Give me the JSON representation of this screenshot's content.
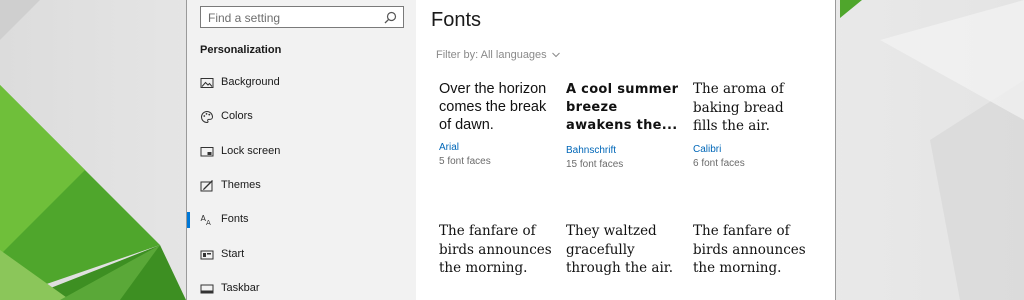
{
  "search": {
    "placeholder": "Find a setting"
  },
  "sidebar": {
    "section_title": "Personalization",
    "items": [
      {
        "label": "Background",
        "icon": "image-icon"
      },
      {
        "label": "Colors",
        "icon": "palette-icon"
      },
      {
        "label": "Lock screen",
        "icon": "lock-screen-icon"
      },
      {
        "label": "Themes",
        "icon": "brush-icon"
      },
      {
        "label": "Fonts",
        "icon": "font-icon",
        "active": true
      },
      {
        "label": "Start",
        "icon": "start-icon"
      },
      {
        "label": "Taskbar",
        "icon": "taskbar-icon"
      }
    ]
  },
  "main": {
    "title": "Fonts",
    "filter_label": "Filter by: All languages",
    "fonts": [
      {
        "sample": "Over the horizon comes the break of dawn.",
        "name": "Arial",
        "faces": "5 font faces"
      },
      {
        "sample": "A cool summer breeze awakens the...",
        "name": "Bahnschrift",
        "faces": "15 font faces"
      },
      {
        "sample": "The aroma of baking bread fills the air.",
        "name": "Calibri",
        "faces": "6 font faces"
      },
      {
        "sample": "The fanfare of birds announces the morning.",
        "name": "",
        "faces": ""
      },
      {
        "sample": "They waltzed gracefully through the air.",
        "name": "",
        "faces": ""
      },
      {
        "sample": "The fanfare of birds announces the morning.",
        "name": "",
        "faces": ""
      }
    ]
  },
  "colors": {
    "accent": "#0078d7",
    "link": "#0067b8",
    "sidebar_bg": "#f2f2f2",
    "wallpaper_green": "#4fa62c"
  }
}
